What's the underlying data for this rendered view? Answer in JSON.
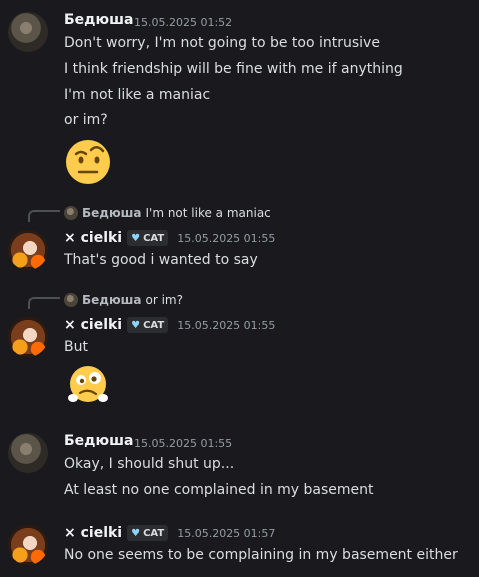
{
  "messages": [
    {
      "author": "Бедюша",
      "timestamp": "15.05.2025 01:52",
      "lines": [
        "Don't worry, I'm not going to be too intrusive",
        "I think friendship will be fine with me if anything",
        "I'm not like a maniac",
        "or im?"
      ],
      "emoji": "face-with-raised-eyebrow-icon"
    },
    {
      "reply_to": {
        "author": "Бедюша",
        "text": "I'm not like a maniac"
      },
      "author": "× cielki",
      "tag": "CAT",
      "timestamp": "15.05.2025 01:55",
      "lines": [
        "That's good i wanted to say"
      ]
    },
    {
      "reply_to": {
        "author": "Бедюша",
        "text": "or im?"
      },
      "author": "× cielki",
      "tag": "CAT",
      "timestamp": "15.05.2025 01:55",
      "lines": [
        "But"
      ],
      "emoji": "woozy-face-icon"
    },
    {
      "author": "Бедюша",
      "timestamp": "15.05.2025 01:55",
      "lines": [
        "Okay, I should shut up...",
        "At least no one complained in my basement"
      ]
    },
    {
      "author": "× cielki",
      "tag": "CAT",
      "timestamp": "15.05.2025 01:57",
      "lines": [
        "No one seems to be complaining in my basement either"
      ]
    }
  ],
  "colors": {
    "background": "#1a1a1e",
    "author": "#f2f3f5",
    "timestamp": "#949ba4",
    "text": "#dbdee1",
    "tag_bg": "#2b2d31",
    "tag_heart": "#8fd3ff"
  }
}
